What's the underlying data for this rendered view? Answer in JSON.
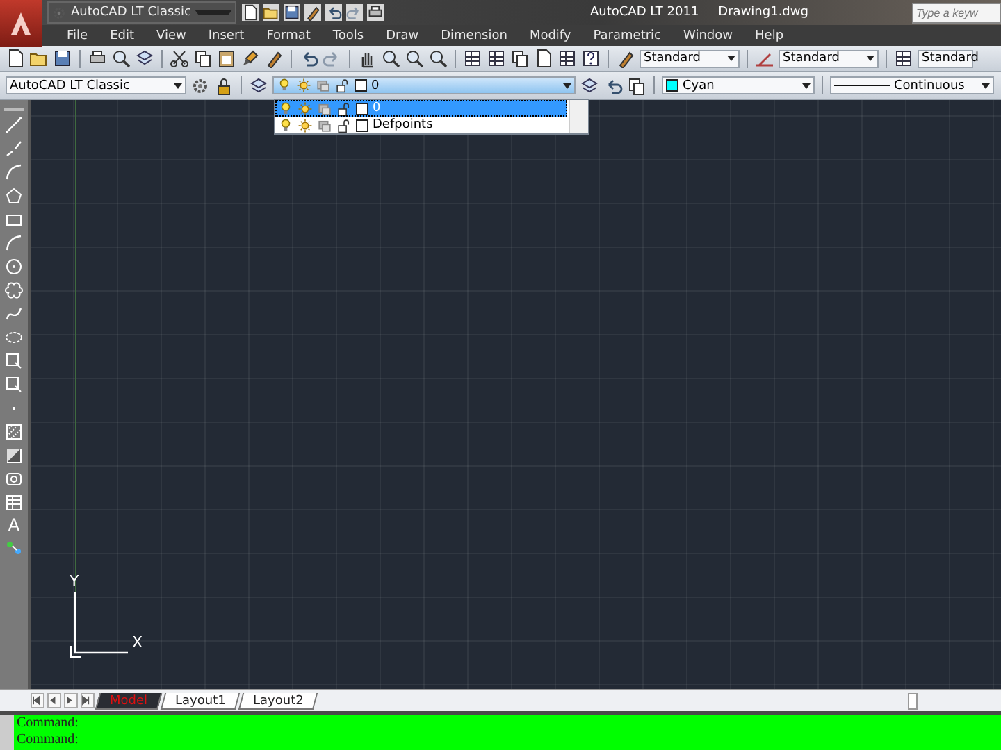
{
  "title_bar": {
    "workspace": "AutoCAD LT Classic",
    "title": "AutoCAD LT 2011",
    "document": "Drawing1.dwg",
    "search": {
      "placeholder": "Type a keyw"
    }
  },
  "menu": [
    "File",
    "Edit",
    "View",
    "Insert",
    "Format",
    "Tools",
    "Draw",
    "Dimension",
    "Modify",
    "Parametric",
    "Window",
    "Help"
  ],
  "style_toolbar": [
    {
      "label": "Standard"
    },
    {
      "label": "Standard"
    },
    {
      "label": "Standard"
    }
  ],
  "workspaces_toolbar": {
    "workspace": "AutoCAD LT Classic"
  },
  "layer_toolbar": {
    "current": {
      "name": "0",
      "on": true,
      "frozen": false,
      "locked": false,
      "color": "#ffffff"
    }
  },
  "layer_list": [
    {
      "name": "0",
      "selected": true,
      "on": true,
      "frozen": false,
      "locked": false,
      "color": "#ffffff"
    },
    {
      "name": "Defpoints",
      "selected": false,
      "on": true,
      "frozen": false,
      "locked": false,
      "color": "#ffffff"
    }
  ],
  "properties_toolbar": {
    "color": {
      "label": "Cyan",
      "color": "#00ffff"
    },
    "linetype": "Continuous"
  },
  "draw_toolbar": {
    "text_tool": "A"
  },
  "ucs": {
    "y": "Y",
    "x": "X"
  },
  "layout_tabs": [
    {
      "label": "Model",
      "selected": true
    },
    {
      "label": "Layout1",
      "selected": false
    },
    {
      "label": "Layout2",
      "selected": false
    }
  ],
  "command_lines": [
    "Command:",
    "Command:"
  ]
}
